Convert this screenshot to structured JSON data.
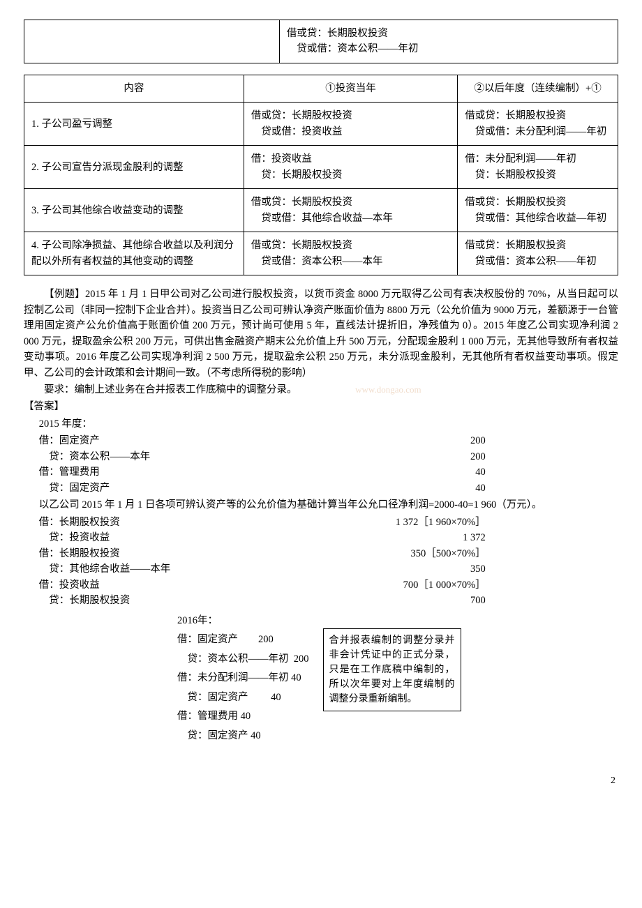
{
  "table1": {
    "left": "",
    "right_line1": "借或贷：长期股权投资",
    "right_line2": "　贷或借：资本公积——年初"
  },
  "table2": {
    "head": [
      "内容",
      "①投资当年",
      "②以后年度（连续编制）+①"
    ],
    "rows": [
      {
        "c1": "1. 子公司盈亏调整",
        "c2a": "借或贷：长期股权投资",
        "c2b": "　贷或借：投资收益",
        "c3a": "借或贷：长期股权投资",
        "c3b": "　贷或借：未分配利润——年初"
      },
      {
        "c1": "2. 子公司宣告分派现金股利的调整",
        "c2a": "借：投资收益",
        "c2b": "　贷：长期股权投资",
        "c3a": "借：未分配利润——年初",
        "c3b": "　贷：长期股权投资"
      },
      {
        "c1": "3. 子公司其他综合收益变动的调整",
        "c2a": "借或贷：长期股权投资",
        "c2b": "　贷或借：其他综合收益—本年",
        "c3a": "借或贷：长期股权投资",
        "c3b": "　贷或借：其他综合收益—年初"
      },
      {
        "c1": "4. 子公司除净损益、其他综合收益以及利润分配以外所有者权益的其他变动的调整",
        "c2a": "借或贷：长期股权投资",
        "c2b": "　贷或借：资本公积——本年",
        "c3a": "借或贷：长期股权投资",
        "c3b": "　贷或借：资本公积——年初"
      }
    ]
  },
  "body": {
    "p1": "【例题】2015 年 1 月 1 日甲公司对乙公司进行股权投资，以货币资金 8000 万元取得乙公司有表决权股份的 70%，从当日起可以控制乙公司（非同一控制下企业合并）。投资当日乙公司可辨认净资产账面价值为 8800 万元（公允价值为 9000 万元，差额源于一台管理用固定资产公允价值高于账面价值 200 万元，预计尚可使用 5 年，直线法计提折旧，净残值为 0）。2015 年度乙公司实现净利润 2 000 万元，提取盈余公积 200 万元，可供出售金融资产期末公允价值上升 500 万元，分配现金股利 1 000 万元，无其他导致所有者权益变动事项。2016 年度乙公司实现净利润 2 500 万元，提取盈余公积 250 万元，未分派现金股利，无其他所有者权益变动事项。假定甲、乙公司的会计政策和会计期间一致。（不考虑所得税的影响）",
    "p2": "要求：编制上述业务在合并报表工作底稿中的调整分录。",
    "watermark": "www.dongao.com",
    "ans_label": "【答案】",
    "y2015": "2015 年度：",
    "e1a": "借：固定资产",
    "e1av": "200",
    "e1b": "　贷：资本公积——本年",
    "e1bv": "200",
    "e2a": "借：管理费用",
    "e2av": "40",
    "e2b": "　贷：固定资产",
    "e2bv": "40",
    "calc": "以乙公司 2015 年 1 月 1 日各项可辨认资产等的公允价值为基础计算当年公允口径净利润=2000-40=1 960（万元）。",
    "e3a": "借：长期股权投资",
    "e3av": "1 372［1 960×70%］",
    "e3b": "　贷：投资收益",
    "e3bv": "1 372",
    "e4a": "借：长期股权投资",
    "e4av": "350［500×70%］",
    "e4b": "　贷：其他综合收益——本年",
    "e4bv": "350",
    "e5a": "借：投资收益",
    "e5av": "700［1 000×70%］",
    "e5b": "　贷：长期股权投资",
    "e5bv": "700"
  },
  "sub": {
    "y2016": "2016年：",
    "l1": "借：固定资产        200",
    "l2": "　贷：资本公积——年初  200",
    "l3": "借：未分配利润——年初 40",
    "l4": "　贷：固定资产         40",
    "l5": "借：管理费用 40",
    "l6": "　贷：固定资产 40"
  },
  "note": "合并报表编制的调整分录并非会计凭证中的正式分录，只是在工作底稿中编制的，所以次年要对上年度编制的调整分录重新编制。",
  "page": "2"
}
